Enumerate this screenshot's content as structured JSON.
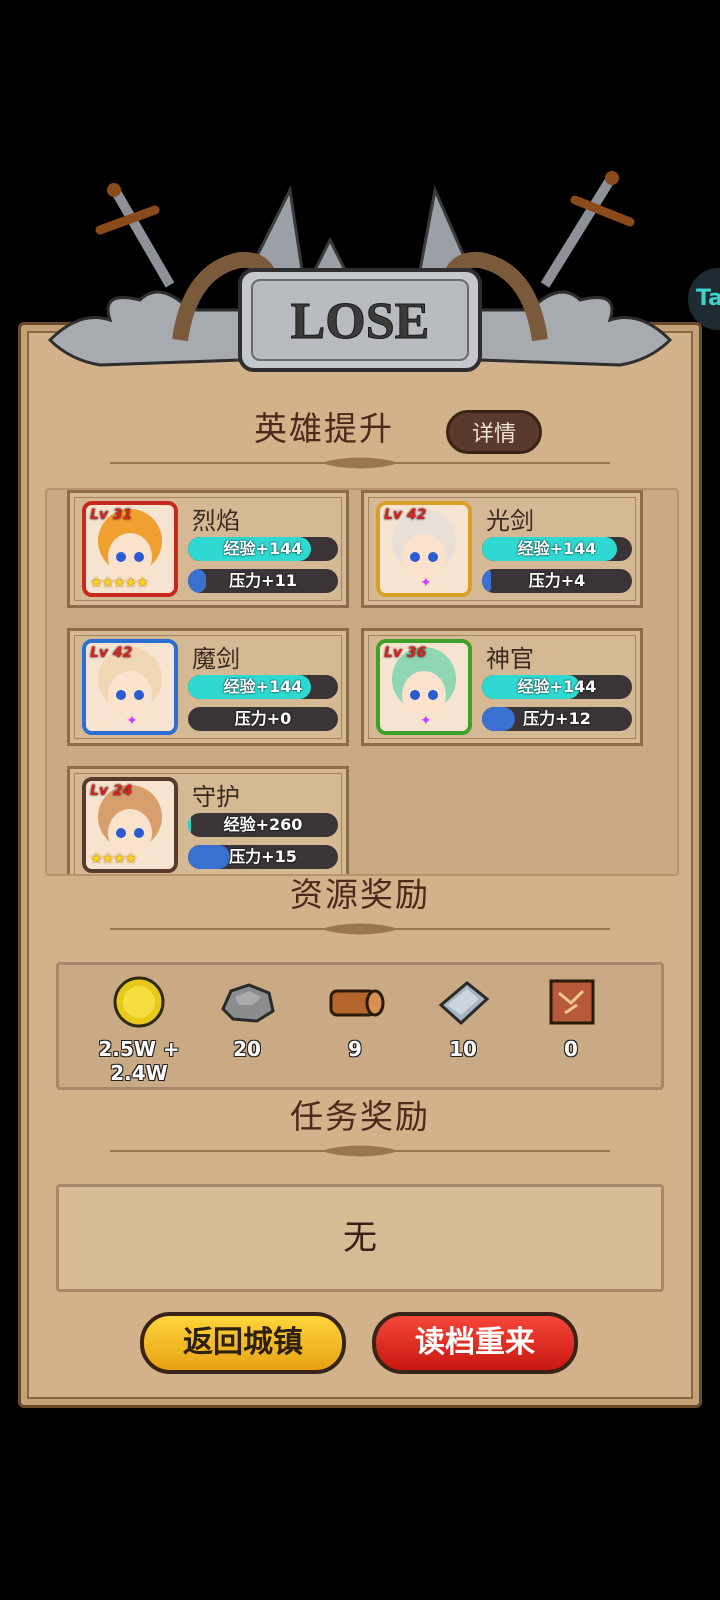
{
  "banner": {
    "title": "LOSE"
  },
  "side_button": {
    "label": "Ta"
  },
  "hero_section": {
    "title": "英雄提升",
    "detail_label": "详情"
  },
  "heroes": [
    {
      "name": "烈焰",
      "level": "Lv 31",
      "exp": "经验+144",
      "pressure": "压力+11",
      "exp_fill": 0.82,
      "pressure_fill": 0.12,
      "stars": "★★★★★",
      "frame": "#c8281c",
      "bg": "#f0a030"
    },
    {
      "name": "光剑",
      "level": "Lv 42",
      "exp": "经验+144",
      "pressure": "压力+4",
      "exp_fill": 0.9,
      "pressure_fill": 0.06,
      "stars": "",
      "frame": "#d8a02a",
      "bg": "#e8e0d8"
    },
    {
      "name": "魔剑",
      "level": "Lv 42",
      "exp": "经验+144",
      "pressure": "压力+0",
      "exp_fill": 0.82,
      "pressure_fill": 0.0,
      "stars": "",
      "frame": "#2b6fd0",
      "bg": "#f1d7b4"
    },
    {
      "name": "神官",
      "level": "Lv 36",
      "exp": "经验+144",
      "pressure": "压力+12",
      "exp_fill": 0.65,
      "pressure_fill": 0.22,
      "stars": "",
      "frame": "#3fa02a",
      "bg": "#8fd6b4"
    },
    {
      "name": "守护",
      "level": "Lv 24",
      "exp": "经验+260",
      "pressure": "压力+15",
      "exp_fill": 0.02,
      "pressure_fill": 0.28,
      "stars": "★★★★",
      "frame": "#5a3a2a",
      "bg": "#d89f6d"
    }
  ],
  "resource_section": {
    "title": "资源奖励"
  },
  "resources": [
    {
      "icon": "gold-coin-icon",
      "value": "2.5W + 2.4W"
    },
    {
      "icon": "stone-icon",
      "value": "20"
    },
    {
      "icon": "wood-log-icon",
      "value": "9"
    },
    {
      "icon": "iron-plate-icon",
      "value": "10"
    },
    {
      "icon": "cloth-icon",
      "value": "0"
    }
  ],
  "task_section": {
    "title": "任务奖励",
    "content": "无"
  },
  "buttons": {
    "return_town": "返回城镇",
    "reload": "读档重来"
  }
}
